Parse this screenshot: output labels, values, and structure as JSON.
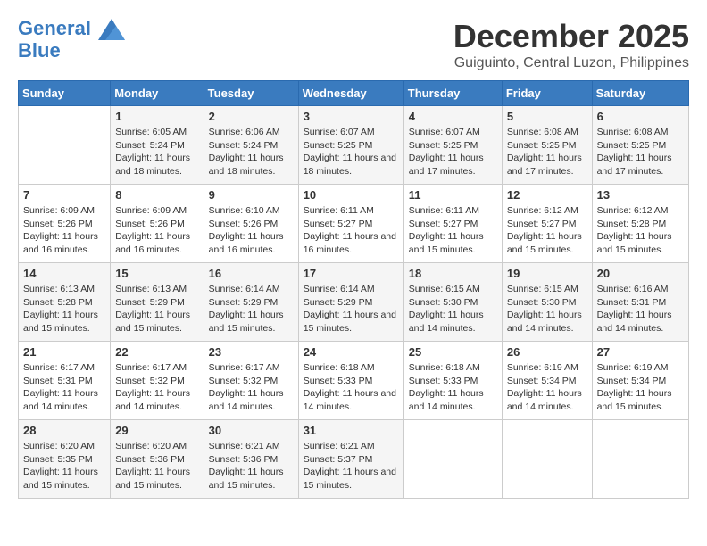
{
  "logo": {
    "line1": "General",
    "line2": "Blue"
  },
  "title": "December 2025",
  "location": "Guiguinto, Central Luzon, Philippines",
  "weekdays": [
    "Sunday",
    "Monday",
    "Tuesday",
    "Wednesday",
    "Thursday",
    "Friday",
    "Saturday"
  ],
  "weeks": [
    [
      {
        "day": "",
        "info": ""
      },
      {
        "day": "1",
        "info": "Sunrise: 6:05 AM\nSunset: 5:24 PM\nDaylight: 11 hours and 18 minutes."
      },
      {
        "day": "2",
        "info": "Sunrise: 6:06 AM\nSunset: 5:24 PM\nDaylight: 11 hours and 18 minutes."
      },
      {
        "day": "3",
        "info": "Sunrise: 6:07 AM\nSunset: 5:25 PM\nDaylight: 11 hours and 18 minutes."
      },
      {
        "day": "4",
        "info": "Sunrise: 6:07 AM\nSunset: 5:25 PM\nDaylight: 11 hours and 17 minutes."
      },
      {
        "day": "5",
        "info": "Sunrise: 6:08 AM\nSunset: 5:25 PM\nDaylight: 11 hours and 17 minutes."
      },
      {
        "day": "6",
        "info": "Sunrise: 6:08 AM\nSunset: 5:25 PM\nDaylight: 11 hours and 17 minutes."
      }
    ],
    [
      {
        "day": "7",
        "info": "Sunrise: 6:09 AM\nSunset: 5:26 PM\nDaylight: 11 hours and 16 minutes."
      },
      {
        "day": "8",
        "info": "Sunrise: 6:09 AM\nSunset: 5:26 PM\nDaylight: 11 hours and 16 minutes."
      },
      {
        "day": "9",
        "info": "Sunrise: 6:10 AM\nSunset: 5:26 PM\nDaylight: 11 hours and 16 minutes."
      },
      {
        "day": "10",
        "info": "Sunrise: 6:11 AM\nSunset: 5:27 PM\nDaylight: 11 hours and 16 minutes."
      },
      {
        "day": "11",
        "info": "Sunrise: 6:11 AM\nSunset: 5:27 PM\nDaylight: 11 hours and 15 minutes."
      },
      {
        "day": "12",
        "info": "Sunrise: 6:12 AM\nSunset: 5:27 PM\nDaylight: 11 hours and 15 minutes."
      },
      {
        "day": "13",
        "info": "Sunrise: 6:12 AM\nSunset: 5:28 PM\nDaylight: 11 hours and 15 minutes."
      }
    ],
    [
      {
        "day": "14",
        "info": "Sunrise: 6:13 AM\nSunset: 5:28 PM\nDaylight: 11 hours and 15 minutes."
      },
      {
        "day": "15",
        "info": "Sunrise: 6:13 AM\nSunset: 5:29 PM\nDaylight: 11 hours and 15 minutes."
      },
      {
        "day": "16",
        "info": "Sunrise: 6:14 AM\nSunset: 5:29 PM\nDaylight: 11 hours and 15 minutes."
      },
      {
        "day": "17",
        "info": "Sunrise: 6:14 AM\nSunset: 5:29 PM\nDaylight: 11 hours and 15 minutes."
      },
      {
        "day": "18",
        "info": "Sunrise: 6:15 AM\nSunset: 5:30 PM\nDaylight: 11 hours and 14 minutes."
      },
      {
        "day": "19",
        "info": "Sunrise: 6:15 AM\nSunset: 5:30 PM\nDaylight: 11 hours and 14 minutes."
      },
      {
        "day": "20",
        "info": "Sunrise: 6:16 AM\nSunset: 5:31 PM\nDaylight: 11 hours and 14 minutes."
      }
    ],
    [
      {
        "day": "21",
        "info": "Sunrise: 6:17 AM\nSunset: 5:31 PM\nDaylight: 11 hours and 14 minutes."
      },
      {
        "day": "22",
        "info": "Sunrise: 6:17 AM\nSunset: 5:32 PM\nDaylight: 11 hours and 14 minutes."
      },
      {
        "day": "23",
        "info": "Sunrise: 6:17 AM\nSunset: 5:32 PM\nDaylight: 11 hours and 14 minutes."
      },
      {
        "day": "24",
        "info": "Sunrise: 6:18 AM\nSunset: 5:33 PM\nDaylight: 11 hours and 14 minutes."
      },
      {
        "day": "25",
        "info": "Sunrise: 6:18 AM\nSunset: 5:33 PM\nDaylight: 11 hours and 14 minutes."
      },
      {
        "day": "26",
        "info": "Sunrise: 6:19 AM\nSunset: 5:34 PM\nDaylight: 11 hours and 14 minutes."
      },
      {
        "day": "27",
        "info": "Sunrise: 6:19 AM\nSunset: 5:34 PM\nDaylight: 11 hours and 15 minutes."
      }
    ],
    [
      {
        "day": "28",
        "info": "Sunrise: 6:20 AM\nSunset: 5:35 PM\nDaylight: 11 hours and 15 minutes."
      },
      {
        "day": "29",
        "info": "Sunrise: 6:20 AM\nSunset: 5:36 PM\nDaylight: 11 hours and 15 minutes."
      },
      {
        "day": "30",
        "info": "Sunrise: 6:21 AM\nSunset: 5:36 PM\nDaylight: 11 hours and 15 minutes."
      },
      {
        "day": "31",
        "info": "Sunrise: 6:21 AM\nSunset: 5:37 PM\nDaylight: 11 hours and 15 minutes."
      },
      {
        "day": "",
        "info": ""
      },
      {
        "day": "",
        "info": ""
      },
      {
        "day": "",
        "info": ""
      }
    ]
  ]
}
